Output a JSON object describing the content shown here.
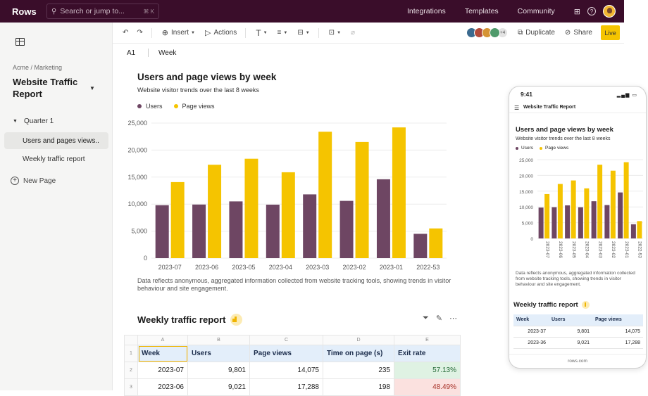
{
  "topbar": {
    "logo": "Rows",
    "search_placeholder": "Search or jump to...",
    "search_shortcut": "⌘ K",
    "links": [
      "Integrations",
      "Templates",
      "Community"
    ]
  },
  "sidebar": {
    "breadcrumb": "Acme / Marketing",
    "doc_title": "Website Traffic Report",
    "section": "Quarter 1",
    "items": [
      "Users and pages views..",
      "Weekly traffic report"
    ],
    "new_page": "New Page"
  },
  "toolbar": {
    "insert": "Insert",
    "actions": "Actions",
    "more_collaborators": "+4",
    "duplicate": "Duplicate",
    "share": "Share",
    "live": "Live"
  },
  "formula": {
    "cell": "A1",
    "value": "Week"
  },
  "chart": {
    "title": "Users and page views by week",
    "subtitle": "Website visitor trends over the last 8 weeks",
    "note": "Data reflects anonymous, aggregated information collected from website tracking tools, showing trends in visitor behaviour and site engagement."
  },
  "chart_data": {
    "type": "bar",
    "title": "Users and page views by week",
    "subtitle": "Website visitor trends over the last 8 weeks",
    "categories": [
      "2023-07",
      "2023-06",
      "2023-05",
      "2023-04",
      "2023-03",
      "2023-02",
      "2023-01",
      "2022-53"
    ],
    "series": [
      {
        "name": "Users",
        "color": "#6e4663",
        "values": [
          9801,
          9921,
          10500,
          9900,
          11800,
          10600,
          14600,
          4500
        ]
      },
      {
        "name": "Page views",
        "color": "#f5c400",
        "values": [
          14075,
          17288,
          18400,
          15900,
          23400,
          21500,
          24200,
          5500
        ]
      }
    ],
    "yticks": [
      "0",
      "5,000",
      "10,000",
      "15,000",
      "20,000",
      "25,000"
    ],
    "ylim": [
      0,
      25000
    ],
    "legend": "top-left",
    "grid": true
  },
  "table": {
    "title": "Weekly traffic report",
    "col_letters": [
      "A",
      "B",
      "C",
      "D",
      "E"
    ],
    "row_numbers": [
      "1",
      "2",
      "3"
    ],
    "headers": [
      "Week",
      "Users",
      "Page views",
      "Time on page (s)",
      "Exit rate"
    ],
    "rows": [
      [
        "2023-07",
        "9,801",
        "14,075",
        "235",
        "57.13%"
      ],
      [
        "2023-06",
        "9,021",
        "17,288",
        "198",
        "48.49%"
      ]
    ]
  },
  "phone": {
    "time": "9:41",
    "doc_title": "Website Traffic Report",
    "chart_title": "Users and page views by week",
    "chart_subtitle": "Website visitor trends over the last 8 weeks",
    "legend": [
      "Users",
      "Page views"
    ],
    "yticks": [
      "0",
      "5,000",
      "10,000",
      "15,000",
      "20,000",
      "25,000"
    ],
    "note": "Data reflects anonymous, aggregated information collected from website tracking tools, showing trends in visitor behaviour and site engagement.",
    "table_title": "Weekly traffic report",
    "table_headers": [
      "Week",
      "Users",
      "Page views"
    ],
    "table_rows": [
      [
        "2023-37",
        "9,801",
        "14,075"
      ],
      [
        "2023-36",
        "9,021",
        "17,288"
      ]
    ],
    "footer": "rows.com"
  }
}
